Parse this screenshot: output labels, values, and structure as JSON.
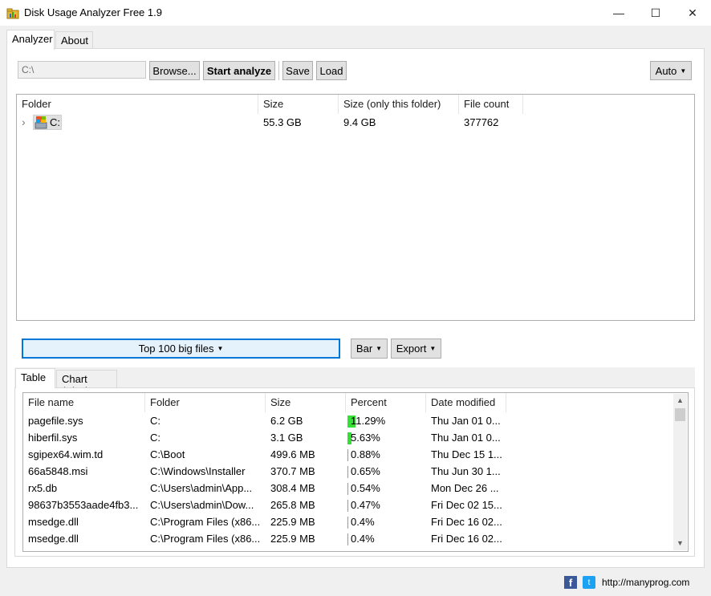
{
  "window": {
    "title": "Disk Usage Analyzer Free 1.9",
    "icon": "folder-chart-icon",
    "controls": {
      "minimize": "—",
      "maximize": "☐",
      "close": "✕"
    }
  },
  "tabs": [
    {
      "label": "Analyzer",
      "active": true
    },
    {
      "label": "About",
      "active": false
    }
  ],
  "toolbar": {
    "path_value": "C:\\",
    "browse_label": "Browse...",
    "start_label": "Start analyze",
    "save_label": "Save",
    "load_label": "Load",
    "auto_label": "Auto"
  },
  "folder_tree": {
    "columns": [
      "Folder",
      "Size",
      "Size (only this folder)",
      "File count"
    ],
    "rows": [
      {
        "expand_glyph": "›",
        "icon": "drive-icon",
        "folder": "C:",
        "size": "55.3 GB",
        "size_only": "9.4 GB",
        "file_count": "377762"
      }
    ]
  },
  "view_controls": {
    "mode_label": "Top 100 big files",
    "chart_type_label": "Bar",
    "export_label": "Export"
  },
  "result_tabs": [
    {
      "label": "Table",
      "active": true
    },
    {
      "label": "Chart (Size)",
      "active": false
    }
  ],
  "files_table": {
    "columns": [
      "File name",
      "Folder",
      "Size",
      "Percent",
      "Date modified"
    ],
    "rows": [
      {
        "name": "pagefile.sys",
        "folder": "C:",
        "size": "6.2 GB",
        "percent": "11.29%",
        "bar": 0.1129,
        "date": "Thu Jan 01 0..."
      },
      {
        "name": "hiberfil.sys",
        "folder": "C:",
        "size": "3.1 GB",
        "percent": "5.63%",
        "bar": 0.0563,
        "date": "Thu Jan 01 0..."
      },
      {
        "name": "sgipex64.wim.td",
        "folder": "C:\\Boot",
        "size": "499.6 MB",
        "percent": "0.88%",
        "bar": 0.0088,
        "date": "Thu Dec 15 1..."
      },
      {
        "name": "66a5848.msi",
        "folder": "C:\\Windows\\Installer",
        "size": "370.7 MB",
        "percent": "0.65%",
        "bar": 0.0065,
        "date": "Thu Jun 30 1..."
      },
      {
        "name": "rx5.db",
        "folder": "C:\\Users\\admin\\App...",
        "size": "308.4 MB",
        "percent": "0.54%",
        "bar": 0.0054,
        "date": "Mon Dec 26 ..."
      },
      {
        "name": "98637b3553aade4fb3...",
        "folder": "C:\\Users\\admin\\Dow...",
        "size": "265.8 MB",
        "percent": "0.47%",
        "bar": 0.0047,
        "date": "Fri Dec 02 15..."
      },
      {
        "name": "msedge.dll",
        "folder": "C:\\Program Files (x86...",
        "size": "225.9 MB",
        "percent": "0.4%",
        "bar": 0.004,
        "date": "Fri Dec 16 02..."
      },
      {
        "name": "msedge.dll",
        "folder": "C:\\Program Files (x86...",
        "size": "225.9 MB",
        "percent": "0.4%",
        "bar": 0.004,
        "date": "Fri Dec 16 02..."
      }
    ]
  },
  "footer": {
    "facebook_glyph": "f",
    "twitter_glyph": "t",
    "website": "http://manyprog.com"
  },
  "colors": {
    "accent": "#0078d7",
    "percent_bar": "#33e033",
    "facebook": "#3b5998",
    "twitter": "#1da1f2"
  }
}
